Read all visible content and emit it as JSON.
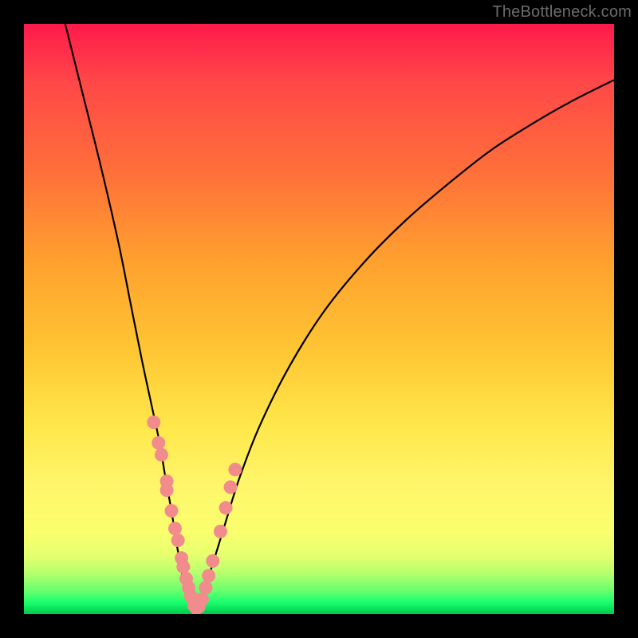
{
  "watermark": "TheBottleneck.com",
  "colors": {
    "frame": "#000000",
    "curve": "#000000",
    "dot_fill": "#f28b8b",
    "dot_stroke": "#d46a6a"
  },
  "chart_data": {
    "type": "line",
    "title": "",
    "xlabel": "",
    "ylabel": "",
    "xlim": [
      0,
      100
    ],
    "ylim": [
      0,
      100
    ],
    "note": "No axes, ticks, legend or labels are rendered in the image. x and y are normalized 0..100 of the plot area (origin bottom-left). The left and right curves together form a V-shaped bottleneck profile; scatter dots cluster near the valley.",
    "series": [
      {
        "name": "left_arm",
        "kind": "line",
        "x": [
          7,
          10,
          13,
          16,
          18,
          20,
          21.5,
          23,
          24,
          25,
          25.7,
          26.3,
          26.8,
          27.2,
          27.7,
          28.2,
          28.8
        ],
        "y": [
          100,
          88,
          76,
          63,
          53,
          43,
          36,
          29,
          23,
          17.5,
          13,
          9.5,
          6.8,
          4.6,
          2.8,
          1.3,
          0.2
        ]
      },
      {
        "name": "right_arm",
        "kind": "line",
        "x": [
          28.8,
          29.5,
          30.5,
          32,
          34,
          36.5,
          40,
          45,
          51,
          58,
          65,
          72,
          79,
          86,
          93,
          100
        ],
        "y": [
          0.2,
          1.5,
          4,
          8.5,
          15,
          23,
          32,
          42,
          51.5,
          60,
          67,
          73,
          78.5,
          83,
          87,
          90.5
        ]
      },
      {
        "name": "dots",
        "kind": "scatter",
        "x": [
          22.0,
          22.8,
          23.3,
          24.2,
          24.2,
          25.0,
          25.6,
          26.1,
          26.7,
          27.0,
          27.5,
          27.9,
          28.3,
          28.8,
          29.2,
          29.6,
          30.2,
          30.8,
          31.3,
          32.0,
          33.3,
          34.2,
          35.0,
          35.8
        ],
        "y": [
          32.5,
          29.0,
          27.0,
          22.5,
          21.0,
          17.5,
          14.5,
          12.5,
          9.5,
          8.0,
          6.0,
          4.5,
          3.0,
          1.5,
          1.0,
          1.2,
          2.5,
          4.5,
          6.5,
          9.0,
          14.0,
          18.0,
          21.5,
          24.5
        ]
      }
    ]
  }
}
